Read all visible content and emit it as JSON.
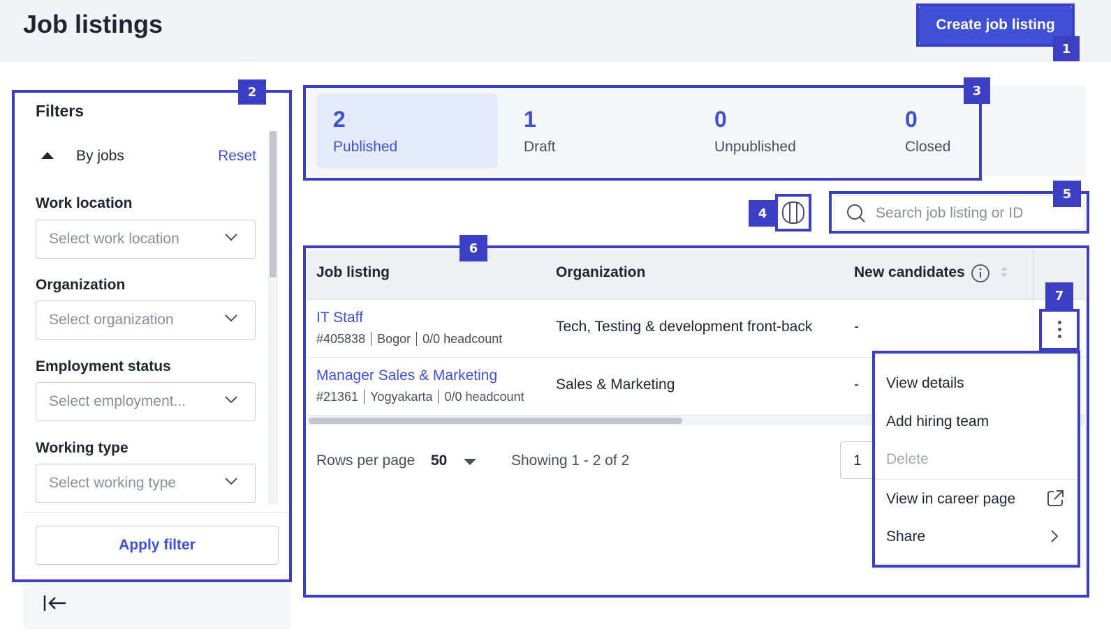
{
  "header": {
    "title": "Job listings",
    "create_label": "Create job listing"
  },
  "filters": {
    "title": "Filters",
    "section_label": "By jobs",
    "reset_label": "Reset",
    "fields": [
      {
        "label": "Work location",
        "placeholder": "Select work location"
      },
      {
        "label": "Organization",
        "placeholder": "Select organization"
      },
      {
        "label": "Employment status",
        "placeholder": "Select employment..."
      },
      {
        "label": "Working type",
        "placeholder": "Select working type"
      }
    ],
    "apply_label": "Apply filter"
  },
  "status_tabs": [
    {
      "count": "2",
      "label": "Published",
      "active": true
    },
    {
      "count": "1",
      "label": "Draft",
      "active": false
    },
    {
      "count": "0",
      "label": "Unpublished",
      "active": false
    },
    {
      "count": "0",
      "label": "Closed",
      "active": false
    }
  ],
  "search": {
    "placeholder": "Search job listing or ID"
  },
  "table": {
    "columns": [
      "Job listing",
      "Organization",
      "New candidates"
    ],
    "rows": [
      {
        "title": "IT Staff",
        "id": "#405838",
        "location": "Bogor",
        "headcount": "0/0 headcount",
        "organization": "Tech, Testing & development front-back",
        "new_candidates": "-"
      },
      {
        "title": "Manager Sales & Marketing",
        "id": "#21361",
        "location": "Yogyakarta",
        "headcount": "0/0 headcount",
        "organization": "Sales & Marketing",
        "new_candidates": "-"
      }
    ],
    "scroll_position": 0.48
  },
  "pagination": {
    "rows_label": "Rows per page",
    "rows_value": "50",
    "showing": "Showing 1 - 2 of 2",
    "page": "1"
  },
  "menu": {
    "items": [
      "View details",
      "Add hiring team",
      "Delete",
      "View in career page",
      "Share"
    ]
  },
  "annotations": [
    "1",
    "2",
    "3",
    "4",
    "5",
    "6",
    "7"
  ],
  "colors": {
    "accent": "#3f4fd6",
    "annotation": "#3a3fc4",
    "active_tab_bg": "#e4ecfb"
  }
}
